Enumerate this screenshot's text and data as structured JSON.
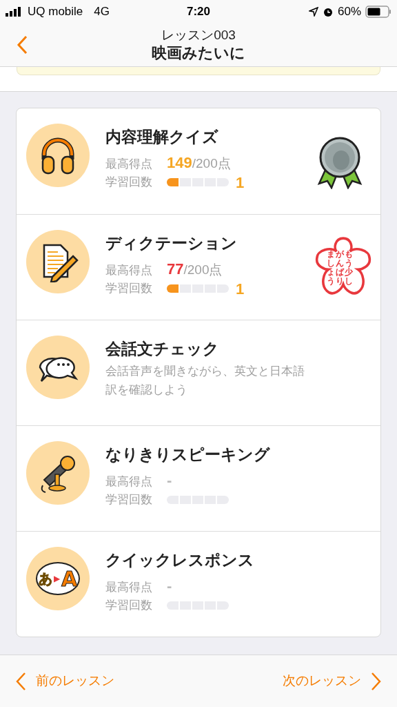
{
  "status_bar": {
    "carrier": "UQ mobile",
    "network": "4G",
    "time": "7:20",
    "battery": "60%"
  },
  "header": {
    "subtitle": "レッスン003",
    "title": "映画みたいに"
  },
  "activities": [
    {
      "kind": "score",
      "title": "内容理解クイズ",
      "score_label": "最高得点",
      "score": "149",
      "color": "#f5a623",
      "score_total": "/200点",
      "count_label": "学習回数",
      "level": 0.2,
      "count": "1",
      "award": {
        "kind": "medal"
      }
    },
    {
      "kind": "score",
      "title": "ディクテーション",
      "score_label": "最高得点",
      "score": "77",
      "color": "#e8383d",
      "score_total": "/200点",
      "count_label": "学習回数",
      "level": 0.2,
      "count": "1",
      "award": {
        "kind": "stamp",
        "lines": [
          "ましょう",
          "がんばり",
          "もう少し"
        ]
      }
    },
    {
      "kind": "description",
      "title": "会話文チェック",
      "description": "会話音声を聞きながら、英文と日本語訳を確認しよう"
    },
    {
      "kind": "score",
      "title": "なりきりスピーキング",
      "score_label": "最高得点",
      "score": "-",
      "color": "#bbbbbb",
      "count_label": "学習回数"
    },
    {
      "kind": "score",
      "icon_glyphs": [
        "あ",
        "▶",
        "A"
      ],
      "title": "クイックレスポンス",
      "score_label": "最高得点",
      "score": "-",
      "color": "#bbbbbb",
      "count_label": "学習回数"
    }
  ],
  "footer": {
    "previous": "前のレッスン",
    "next": "次のレッスン"
  }
}
